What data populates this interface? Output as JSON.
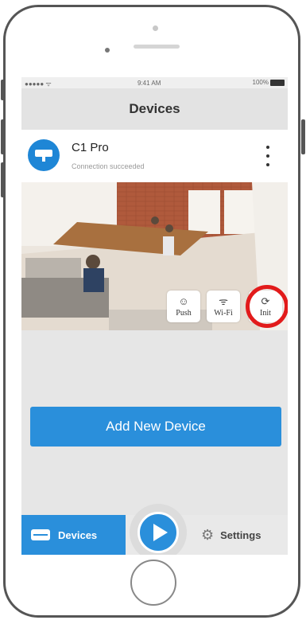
{
  "statusbar": {
    "signal": "●●●●● ᯤ",
    "time": "9:41 AM",
    "battery": "100%"
  },
  "navbar": {
    "title": "Devices"
  },
  "device": {
    "name": "C1 Pro",
    "status": "Connection succeeded"
  },
  "preview_actions": [
    {
      "label": "Push",
      "icon": "☺"
    },
    {
      "label": "Wi-Fi",
      "icon": "ᯤ"
    },
    {
      "label": "Init",
      "icon": "⟳"
    }
  ],
  "add_device": {
    "label": "Add New Device"
  },
  "tabbar": {
    "devices_label": "Devices",
    "settings_label": "Settings"
  },
  "colors": {
    "accent": "#2a8fdb",
    "highlight": "#e21b1b"
  }
}
